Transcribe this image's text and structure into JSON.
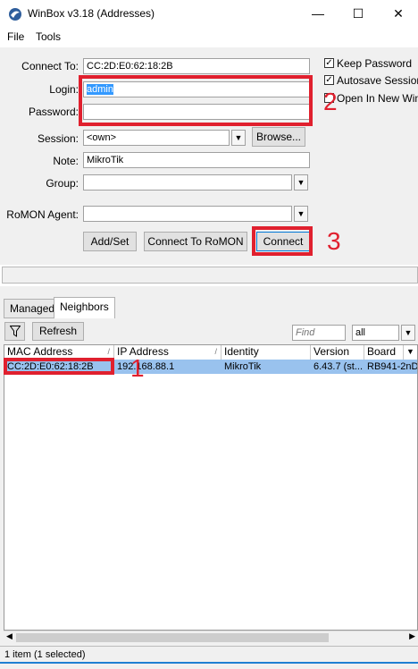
{
  "window": {
    "title": "WinBox v3.18 (Addresses)",
    "min_glyph": "—",
    "max_glyph": "☐",
    "close_glyph": "✕"
  },
  "menu": {
    "file": "File",
    "tools": "Tools"
  },
  "form": {
    "connect_to_label": "Connect To:",
    "connect_to_value": "CC:2D:E0:62:18:2B",
    "login_label": "Login:",
    "login_value": "admin",
    "password_label": "Password:",
    "password_value": "",
    "session_label": "Session:",
    "session_value": "<own>",
    "browse_label": "Browse...",
    "note_label": "Note:",
    "note_value": "MikroTik",
    "group_label": "Group:",
    "group_value": "",
    "romon_label": "RoMON Agent:",
    "romon_value": "",
    "add_set_label": "Add/Set",
    "connect_romon_label": "Connect To RoMON",
    "connect_label": "Connect"
  },
  "options": {
    "keep_password": {
      "label": "Keep Password",
      "checked": true
    },
    "autosave_session": {
      "label": "Autosave Session",
      "checked": true
    },
    "open_new_window": {
      "label": "Open In New Wind",
      "checked": false
    }
  },
  "annotations": {
    "n1": "1",
    "n2": "2",
    "n3": "3",
    "color": "#e0202e"
  },
  "tabs": {
    "managed": "Managed",
    "neighbors": "Neighbors"
  },
  "toolbar": {
    "refresh_label": "Refresh",
    "find_placeholder": "Find",
    "filter_value": "all"
  },
  "table": {
    "headers": [
      "MAC Address",
      "IP Address",
      "Identity",
      "Version",
      "Board"
    ],
    "rows": [
      {
        "mac": "CC:2D:E0:62:18:2B",
        "ip": "192.168.88.1",
        "identity": "MikroTik",
        "version": "6.43.7 (st...",
        "board": "RB941-2nD"
      }
    ]
  },
  "status": {
    "text": "1 item (1 selected)"
  }
}
